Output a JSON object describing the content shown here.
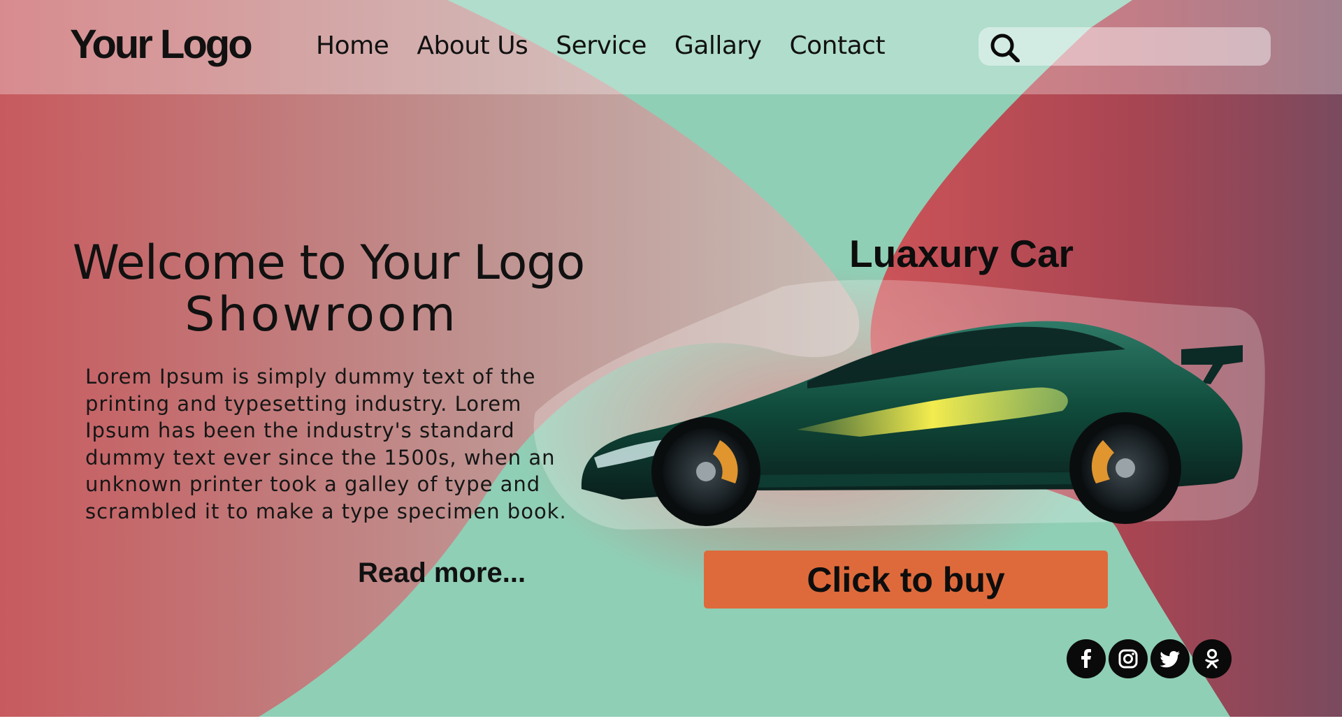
{
  "header": {
    "logo": "Your Logo",
    "nav": [
      "Home",
      "About Us",
      "Service",
      "Gallary",
      "Contact"
    ],
    "search": {
      "value": "",
      "placeholder": "",
      "icon": "search-icon"
    }
  },
  "hero": {
    "title_line1": "Welcome to Your Logo",
    "title_line2": "Showroom",
    "body": "Lorem Ipsum is simply dummy text of the printing and typesetting industry. Lorem Ipsum has been the industry's standard dummy text ever since the 1500s, when an unknown printer took a galley of type and scrambled it to make a type specimen book.",
    "read_more": "Read more..."
  },
  "product": {
    "title": "Luaxury Car",
    "image": "green-sports-car",
    "buy_label": "Click to buy"
  },
  "social": [
    "facebook-icon",
    "instagram-icon",
    "twitter-icon",
    "odnoklassniki-icon"
  ],
  "colors": {
    "mint": "#8fcfb6",
    "coral_red": "#c9545a",
    "plum": "#7c4a5c",
    "button_orange": "#de6a3b",
    "text": "#111111"
  }
}
